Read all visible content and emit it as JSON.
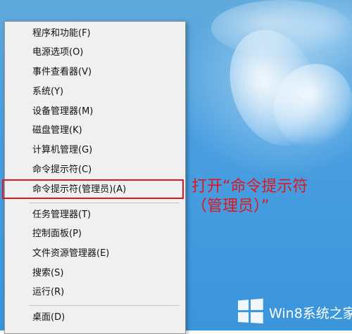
{
  "menu": {
    "items": [
      {
        "label": "程序和功能(F)"
      },
      {
        "label": "电源选项(O)"
      },
      {
        "label": "事件查看器(V)"
      },
      {
        "label": "系统(Y)"
      },
      {
        "label": "设备管理器(M)"
      },
      {
        "label": "磁盘管理(K)"
      },
      {
        "label": "计算机管理(G)"
      },
      {
        "label": "命令提示符(C)"
      },
      {
        "label": "命令提示符(管理员)(A)"
      },
      {
        "label": "任务管理器(T)"
      },
      {
        "label": "控制面板(P)"
      },
      {
        "label": "文件资源管理器(E)"
      },
      {
        "label": "搜索(S)"
      },
      {
        "label": "运行(R)"
      },
      {
        "label": "桌面(D)"
      }
    ]
  },
  "annotation": {
    "line1": "打开“命令提示符",
    "line2": "（管理员）”"
  },
  "watermark": {
    "text": "Win8系统之家"
  },
  "colors": {
    "highlight": "#e0161c",
    "desktop": "#4a9fe0"
  }
}
